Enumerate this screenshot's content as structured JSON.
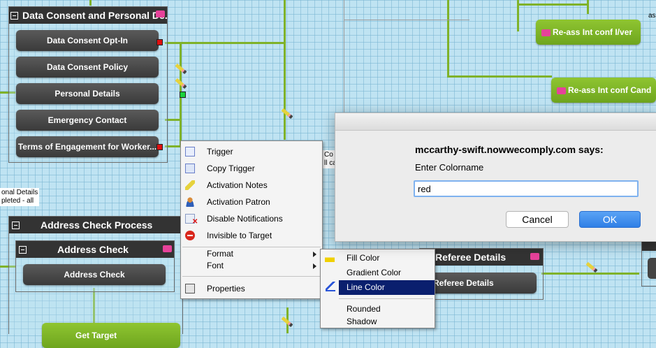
{
  "process_dc": {
    "title": "Data Consent and Personal De...",
    "items": [
      "Data Consent Opt-In",
      "Data Consent Policy",
      "Personal Details",
      "Emergency Contact",
      "Terms of Engagement for Worker..."
    ]
  },
  "process_addr": {
    "title": "Address Check Process",
    "sub_title": "Address Check",
    "item": "Address Check"
  },
  "green_nodes": {
    "reass_iver": "Re-ass Int conf I/ver",
    "reass_cand": "Re-ass Int conf Cand",
    "bottom_partial": "Get Target"
  },
  "referee": {
    "title": "Referee Details",
    "item": "Referee Details"
  },
  "notes": {
    "left_line1": "onal Details",
    "left_line2": "pleted - all",
    "mid_line1": "Co",
    "mid_line2": "ll ca",
    "top_right": "as"
  },
  "context_menu": {
    "items": [
      {
        "label": "Trigger",
        "icon": "checklist-icon"
      },
      {
        "label": "Copy Trigger",
        "icon": "copy-icon"
      },
      {
        "label": "Activation Notes",
        "icon": "pencil-icon"
      },
      {
        "label": "Activation Patron",
        "icon": "person-icon"
      },
      {
        "label": "Disable Notifications",
        "icon": "envelope-x-icon"
      },
      {
        "label": "Invisible to Target",
        "icon": "no-entry-icon"
      }
    ],
    "format": "Format",
    "font": "Font",
    "properties": "Properties"
  },
  "submenu": {
    "fill": "Fill Color",
    "gradient": "Gradient Color",
    "line": "Line Color",
    "rounded": "Rounded",
    "shadow": "Shadow"
  },
  "dialog": {
    "title": "mccarthy-swift.nowwecomply.com says:",
    "prompt": "Enter Colorname",
    "input_value": "red",
    "cancel": "Cancel",
    "ok": "OK"
  },
  "colors": {
    "accent_green": "#7fb22a",
    "selection_blue": "#0a1f6e",
    "ok_blue": "#3b8ff0",
    "port_red": "#e01010",
    "port_green": "#19d13a"
  }
}
